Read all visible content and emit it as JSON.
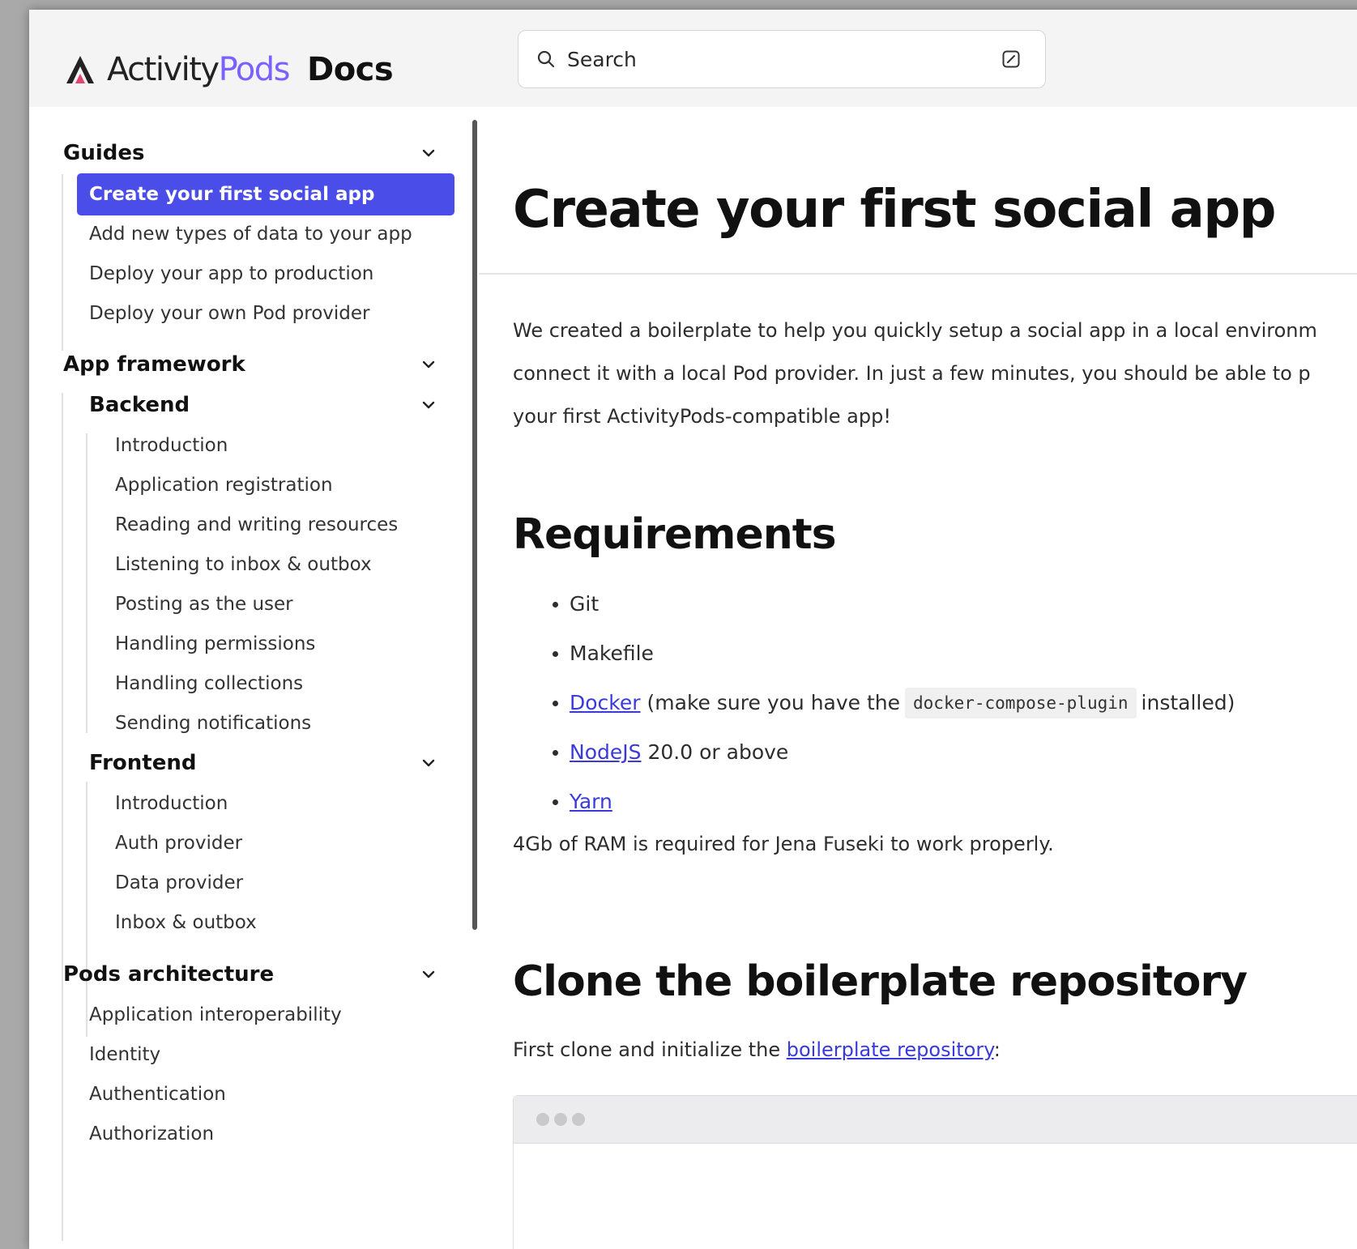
{
  "header": {
    "brand_main": "Activity",
    "brand_accent": "Pods",
    "brand_docs": "Docs",
    "search_placeholder": "Search"
  },
  "sidebar": {
    "guides": {
      "title": "Guides",
      "items": [
        "Create your first social app",
        "Add new types of data to your app",
        "Deploy your app to production",
        "Deploy your own Pod provider"
      ],
      "active_index": 0
    },
    "app_framework": {
      "title": "App framework",
      "backend": {
        "title": "Backend",
        "items": [
          "Introduction",
          "Application registration",
          "Reading and writing resources",
          "Listening to inbox & outbox",
          "Posting as the user",
          "Handling permissions",
          "Handling collections",
          "Sending notifications"
        ]
      },
      "frontend": {
        "title": "Frontend",
        "items": [
          "Introduction",
          "Auth provider",
          "Data provider",
          "Inbox & outbox"
        ]
      }
    },
    "pods_architecture": {
      "title": "Pods architecture",
      "items": [
        "Application interoperability",
        "Identity",
        "Authentication",
        "Authorization"
      ]
    }
  },
  "main": {
    "title": "Create your first social app",
    "intro_lines": [
      "We created a boilerplate to help you quickly setup a social app in a local environm",
      "connect it with a local Pod provider. In just a few minutes, you should be able to p",
      "your first ActivityPods-compatible app!"
    ],
    "requirements": {
      "heading": "Requirements",
      "git": "Git",
      "makefile": "Makefile",
      "docker_link": "Docker",
      "docker_pre": "(make sure you have the",
      "docker_code": "docker-compose-plugin",
      "docker_post": "installed)",
      "node_link": "NodeJS",
      "node_rest": "20.0 or above",
      "yarn_link": "Yarn"
    },
    "ram_note": "4Gb of RAM is required for Jena Fuseki to work properly.",
    "clone": {
      "heading": "Clone the boilerplate repository",
      "text_pre": "First clone and initialize the",
      "link": "boilerplate repository",
      "text_post": ":"
    }
  },
  "colors": {
    "accent": "#7b61ff",
    "active_bg": "#4a4de8",
    "link": "#3a3adb"
  },
  "icons": [
    "activitypods-logo-icon",
    "search-icon",
    "keyboard-shortcut-icon",
    "chevron-down-icon",
    "window-dots-icon"
  ]
}
